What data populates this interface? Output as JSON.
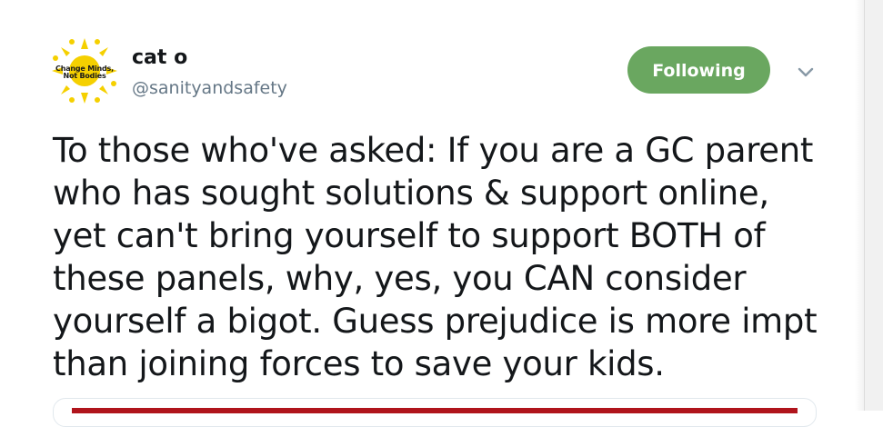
{
  "profile": {
    "display_name": "cat o",
    "handle": "@sanityandsafety",
    "avatar_text_line1": "Change Minds,",
    "avatar_text_line2": "Not Bodies"
  },
  "actions": {
    "follow_label": "Following",
    "more_icon": "chevron-down-icon"
  },
  "tweet": {
    "lines": [
      "To those who've asked: If you are a GC parent",
      "who has sought solutions & support online,",
      "yet can't bring yourself to support BOTH of",
      "these panels, why, yes, you CAN consider",
      "yourself a bigot. Guess prejudice is more impt",
      "than joining forces to save your kids."
    ]
  },
  "colors": {
    "follow_button": "#6aa760",
    "handle": "#657786",
    "text": "#14171a",
    "avatar_sun": "#f5d000",
    "media_strip": "#b0141c"
  }
}
